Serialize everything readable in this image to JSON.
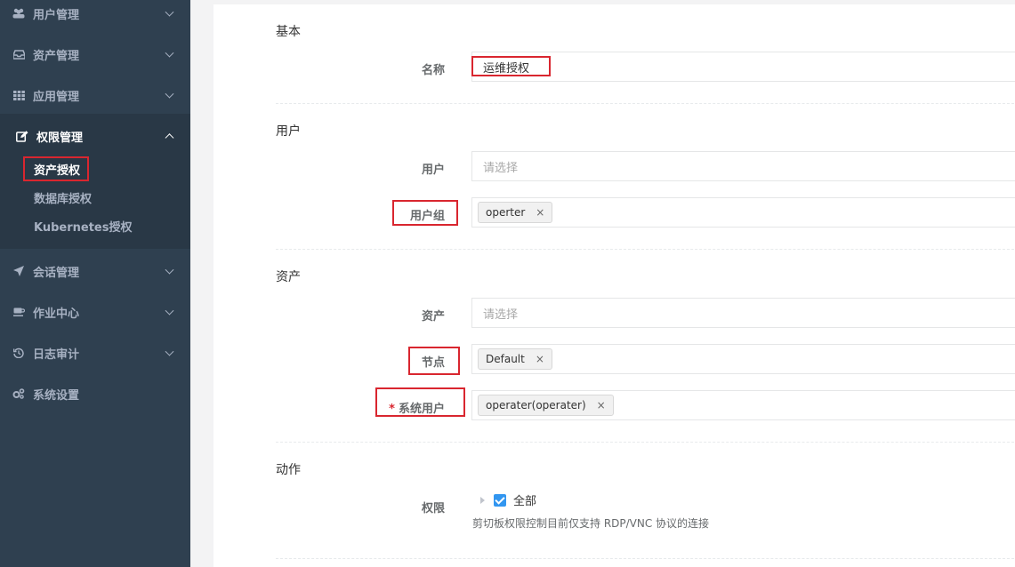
{
  "sidebar": {
    "items": [
      {
        "label": "用户管理",
        "icon": "users-icon"
      },
      {
        "label": "资产管理",
        "icon": "inbox-icon"
      },
      {
        "label": "应用管理",
        "icon": "th-icon"
      },
      {
        "label": "权限管理",
        "icon": "edit-icon"
      },
      {
        "label": "会话管理",
        "icon": "rocket-icon"
      },
      {
        "label": "作业中心",
        "icon": "coffee-icon"
      },
      {
        "label": "日志审计",
        "icon": "history-icon"
      },
      {
        "label": "系统设置",
        "icon": "gears-icon"
      }
    ],
    "sub_items": [
      "资产授权",
      "数据库授权",
      "Kubernetes授权"
    ]
  },
  "form": {
    "basic": {
      "title": "基本",
      "name_label": "名称",
      "name_value": "运维授权"
    },
    "user": {
      "title": "用户",
      "user_label": "用户",
      "user_placeholder": "请选择",
      "group_label": "用户组",
      "group_tag": "operter"
    },
    "asset": {
      "title": "资产",
      "asset_label": "资产",
      "asset_placeholder": "请选择",
      "node_label": "节点",
      "node_tag": "Default",
      "sysuser_label": "系统用户",
      "sysuser_required": "*",
      "sysuser_tag": "operater(operater)"
    },
    "action": {
      "title": "动作",
      "perm_label": "权限",
      "all_label": "全部",
      "help_text": "剪切板权限控制目前仅支持 RDP/VNC 协议的连接"
    },
    "tag_remove": "×"
  },
  "colors": {
    "sidebar_bg": "#2f4050",
    "sidebar_active_bg": "#293846",
    "highlight_red": "#d9262f",
    "checkbox_blue": "#3296f0"
  }
}
